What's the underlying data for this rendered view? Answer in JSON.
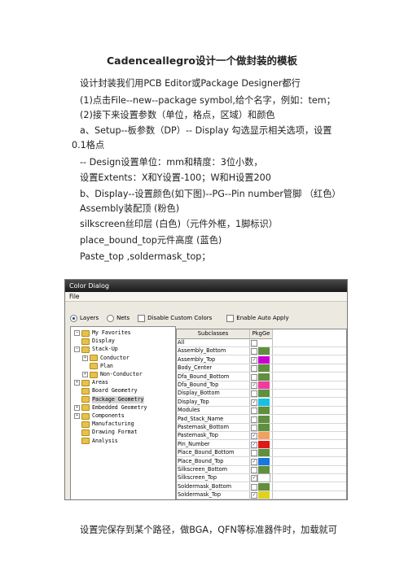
{
  "title": "Cadenceallegro设计一个做封装的模板",
  "paragraphs": {
    "p1": "设计封装我们用PCB Editor或Package Designer都行",
    "p2": "(1)点击File--new--package symbol,给个名字，例如：tem；",
    "p3": "(2)接下来设置参数（单位，格点，区域）和颜色",
    "p4a": "a、Setup--板参数（DP）-- Display 勾选显示相关选项，设置",
    "p4b": "0.1格点",
    "p5": "-- Design设置单位：mm和精度：3位小数，",
    "p6": "设置Extents：X和Y设置-100；W和H设置200",
    "p7a": "b、Display--设置颜色(如下图)--PG--Pin number管脚 （红色）",
    "p7b": "Assembly装配顶 (粉色)",
    "p8": "silkscreen丝印层 (白色)（元件外框，1脚标识）",
    "p9": "place_bound_top元件高度 (蓝色)",
    "p10": "Paste_top ,soldermask_top；"
  },
  "dialog": {
    "title": "Color Dialog",
    "menu": "File",
    "layers": "Layers",
    "nets": "Nets",
    "disable": "Disable Custom Colors",
    "auto_apply": "Enable Auto Apply",
    "tree": [
      {
        "label": "My Favorites",
        "exp": "−",
        "indent": 0
      },
      {
        "label": "Display",
        "exp": "",
        "indent": 0
      },
      {
        "label": "Stack-Up",
        "exp": "−",
        "indent": 0
      },
      {
        "label": "Conductor",
        "exp": "+",
        "indent": 1
      },
      {
        "label": "Plan",
        "exp": "",
        "indent": 1
      },
      {
        "label": "Non-Conductor",
        "exp": "+",
        "indent": 1
      },
      {
        "label": "Areas",
        "exp": "+",
        "indent": 0
      },
      {
        "label": "Board Geometry",
        "exp": "",
        "indent": 0
      },
      {
        "label": "Package Geometry",
        "exp": "",
        "indent": 0,
        "selected": true
      },
      {
        "label": "Embedded Geometry",
        "exp": "+",
        "indent": 0
      },
      {
        "label": "Components",
        "exp": "+",
        "indent": 0
      },
      {
        "label": "Manufacturing",
        "exp": "",
        "indent": 0
      },
      {
        "label": "Drawing Format",
        "exp": "",
        "indent": 0
      },
      {
        "label": "Analysis",
        "exp": "",
        "indent": 0
      }
    ],
    "grid_headers": {
      "subclasses": "Subclasses",
      "pkg": "PkgGe"
    },
    "rows": [
      {
        "name": "All",
        "checked": false,
        "color": ""
      },
      {
        "name": "Assembly_Bottom",
        "checked": false,
        "color": "#5f8f3f"
      },
      {
        "name": "Assembly_Top",
        "checked": true,
        "color": "#c800d0"
      },
      {
        "name": "Body_Center",
        "checked": false,
        "color": "#5f8f3f"
      },
      {
        "name": "Dfa_Bound_Bottom",
        "checked": false,
        "color": "#5f8f3f"
      },
      {
        "name": "Dfa_Bound_Top",
        "checked": true,
        "color": "#f03aa0"
      },
      {
        "name": "Display_Bottom",
        "checked": false,
        "color": "#5f8f3f"
      },
      {
        "name": "Display_Top",
        "checked": true,
        "color": "#18c0e0"
      },
      {
        "name": "Modules",
        "checked": false,
        "color": "#5f8f3f"
      },
      {
        "name": "Pad_Stack_Name",
        "checked": false,
        "color": "#5f8f3f"
      },
      {
        "name": "Pastemask_Bottom",
        "checked": false,
        "color": "#5f8f3f"
      },
      {
        "name": "Pastemask_Top",
        "checked": true,
        "color": "#f0a060"
      },
      {
        "name": "Pin_Number",
        "checked": true,
        "color": "#e01818"
      },
      {
        "name": "Place_Bound_Bottom",
        "checked": false,
        "color": "#5f8f3f"
      },
      {
        "name": "Place_Bound_Top",
        "checked": true,
        "color": "#1878e0"
      },
      {
        "name": "Silkscreen_Bottom",
        "checked": false,
        "color": "#5f8f3f"
      },
      {
        "name": "Silkscreen_Top",
        "checked": true,
        "color": "#ffffff"
      },
      {
        "name": "Soldermask_Bottom",
        "checked": false,
        "color": "#5f8f3f"
      },
      {
        "name": "Soldermask_Top",
        "checked": true,
        "color": "#e0d020"
      }
    ]
  },
  "footer": "设置完保存到某个路径，做BGA，QFN等标准器件时，加载就可"
}
